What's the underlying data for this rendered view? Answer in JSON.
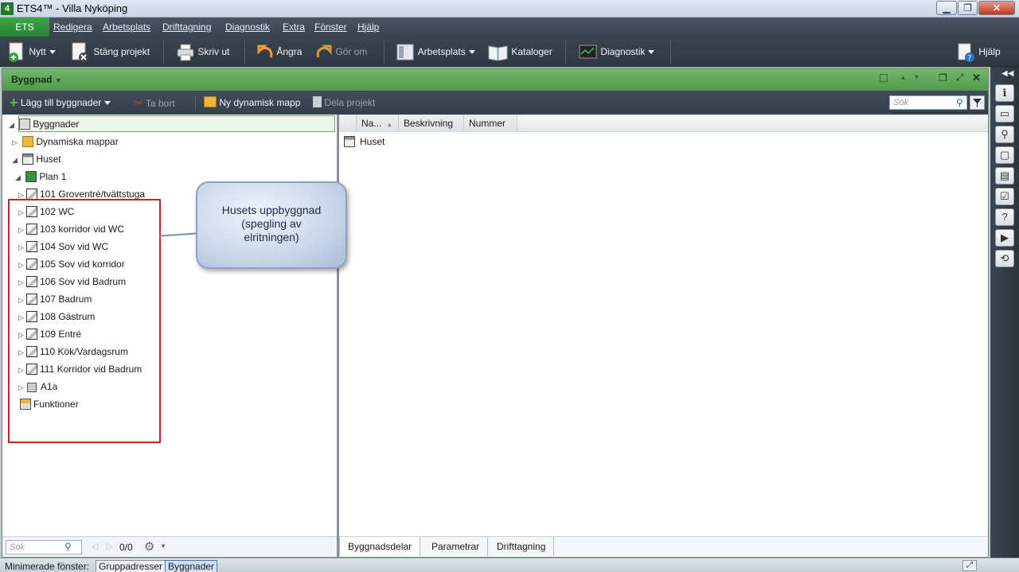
{
  "window": {
    "title": "ETS4™ - Villa Nyköping",
    "logo": "4",
    "controls": [
      "minimize-icon",
      "restore-icon",
      "close-icon"
    ]
  },
  "menubar": {
    "ets_tab": "ETS",
    "items": [
      "Redigera",
      "Arbetsplats",
      "Drifttagning",
      "Diagnostik",
      "Extra",
      "Fönster",
      "Hjälp"
    ]
  },
  "toolbar": {
    "new": "Nytt",
    "close_project": "Stäng projekt",
    "print": "Skriv ut",
    "undo": "Ångra",
    "redo": "Gör om",
    "workspace": "Arbetsplats",
    "catalogs": "Kataloger",
    "diagnostics": "Diagnostik",
    "help": "Hjälp"
  },
  "panel": {
    "title": "Byggnad",
    "subtoolbar": {
      "add_buildings": "Lägg till byggnader",
      "delete": "Ta bort",
      "new_dynamic_folder": "Ny dynamisk mapp",
      "share_project": "Dela projekt",
      "search_placeholder": "Sök"
    },
    "tree": {
      "root": "Byggnader",
      "dynamic_folders": "Dynamiska mappar",
      "building": "Huset",
      "floor": "Plan 1",
      "rooms": [
        "101 Groventré/tvättstuga",
        "102 WC",
        "103 korridor vid WC",
        "104 Sov vid WC",
        "105 Sov vid korridor",
        "106 Sov vid Badrum",
        "107 Badrum",
        "108 Gästrum",
        "109 Entré",
        "110 Kök/Vardagsrum",
        "111 Korridor vid Badrum"
      ],
      "cabinet": "A1a",
      "functions": "Funktioner"
    },
    "tree_footer": {
      "search_placeholder": "Sök",
      "pager": "0/0"
    },
    "grid": {
      "columns": [
        "Na...",
        "Beskrivning",
        "Nummer"
      ],
      "rows": [
        {
          "name": "Huset"
        }
      ],
      "tabs": [
        "Byggnadsdelar",
        "Parametrar",
        "Drifttagning"
      ]
    }
  },
  "callout": {
    "text_line1": "Husets uppbyggnad",
    "text_line2": "(spegling av",
    "text_line3": "elritningen)"
  },
  "statusbar": {
    "label": "Minimerade fönster:",
    "tabs": [
      "Gruppadresser",
      "Byggnader"
    ]
  },
  "colors": {
    "accent_green": "#4f9a4b",
    "toolbar_dark": "#353e49",
    "highlight_red": "#c0272d"
  }
}
